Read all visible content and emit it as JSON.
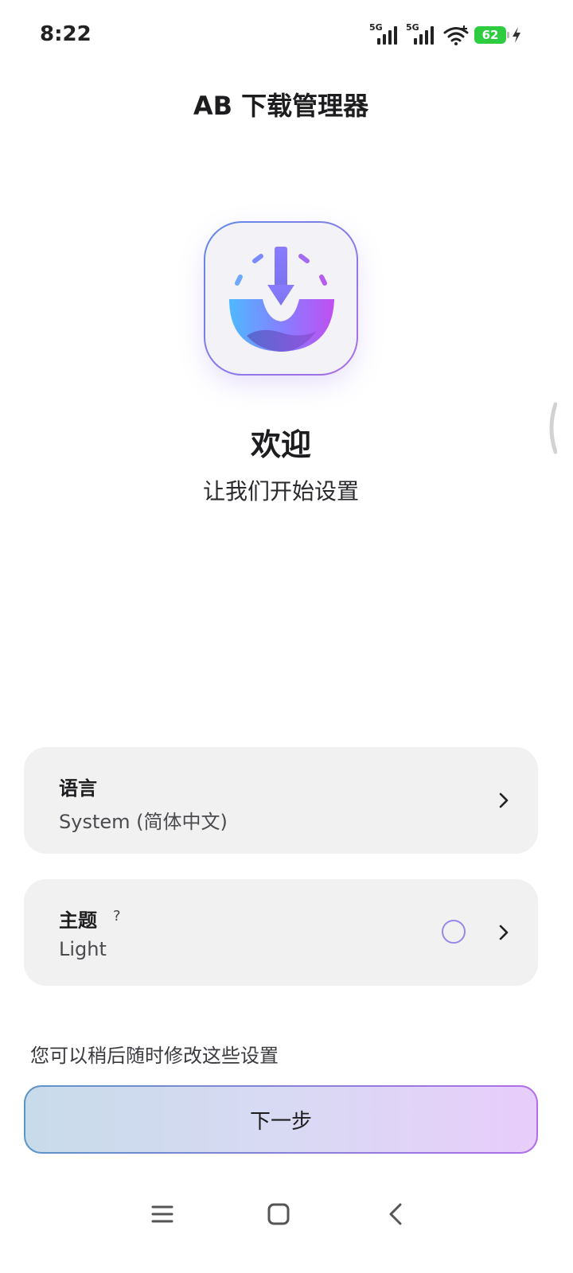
{
  "status_bar": {
    "time": "8:22",
    "network1": "5G",
    "network2": "5G",
    "battery": "62",
    "battery_color": "#2ecc40"
  },
  "header": {
    "title": "AB 下载管理器"
  },
  "logo": {
    "icon": "download-app-logo-icon",
    "gradient_start": "#4fb8ff",
    "gradient_end": "#c04ff0"
  },
  "welcome": {
    "title": "欢迎",
    "subtitle": "让我们开始设置"
  },
  "settings": {
    "language": {
      "label": "语言",
      "value": "System (简体中文)"
    },
    "theme": {
      "label": "主题",
      "help": "?",
      "value": "Light"
    }
  },
  "hint": "您可以稍后随时修改这些设置",
  "next_button": {
    "label": "下一步"
  },
  "nav": {
    "menu_icon": "menu-icon",
    "home_icon": "home-icon",
    "back_icon": "back-icon"
  }
}
